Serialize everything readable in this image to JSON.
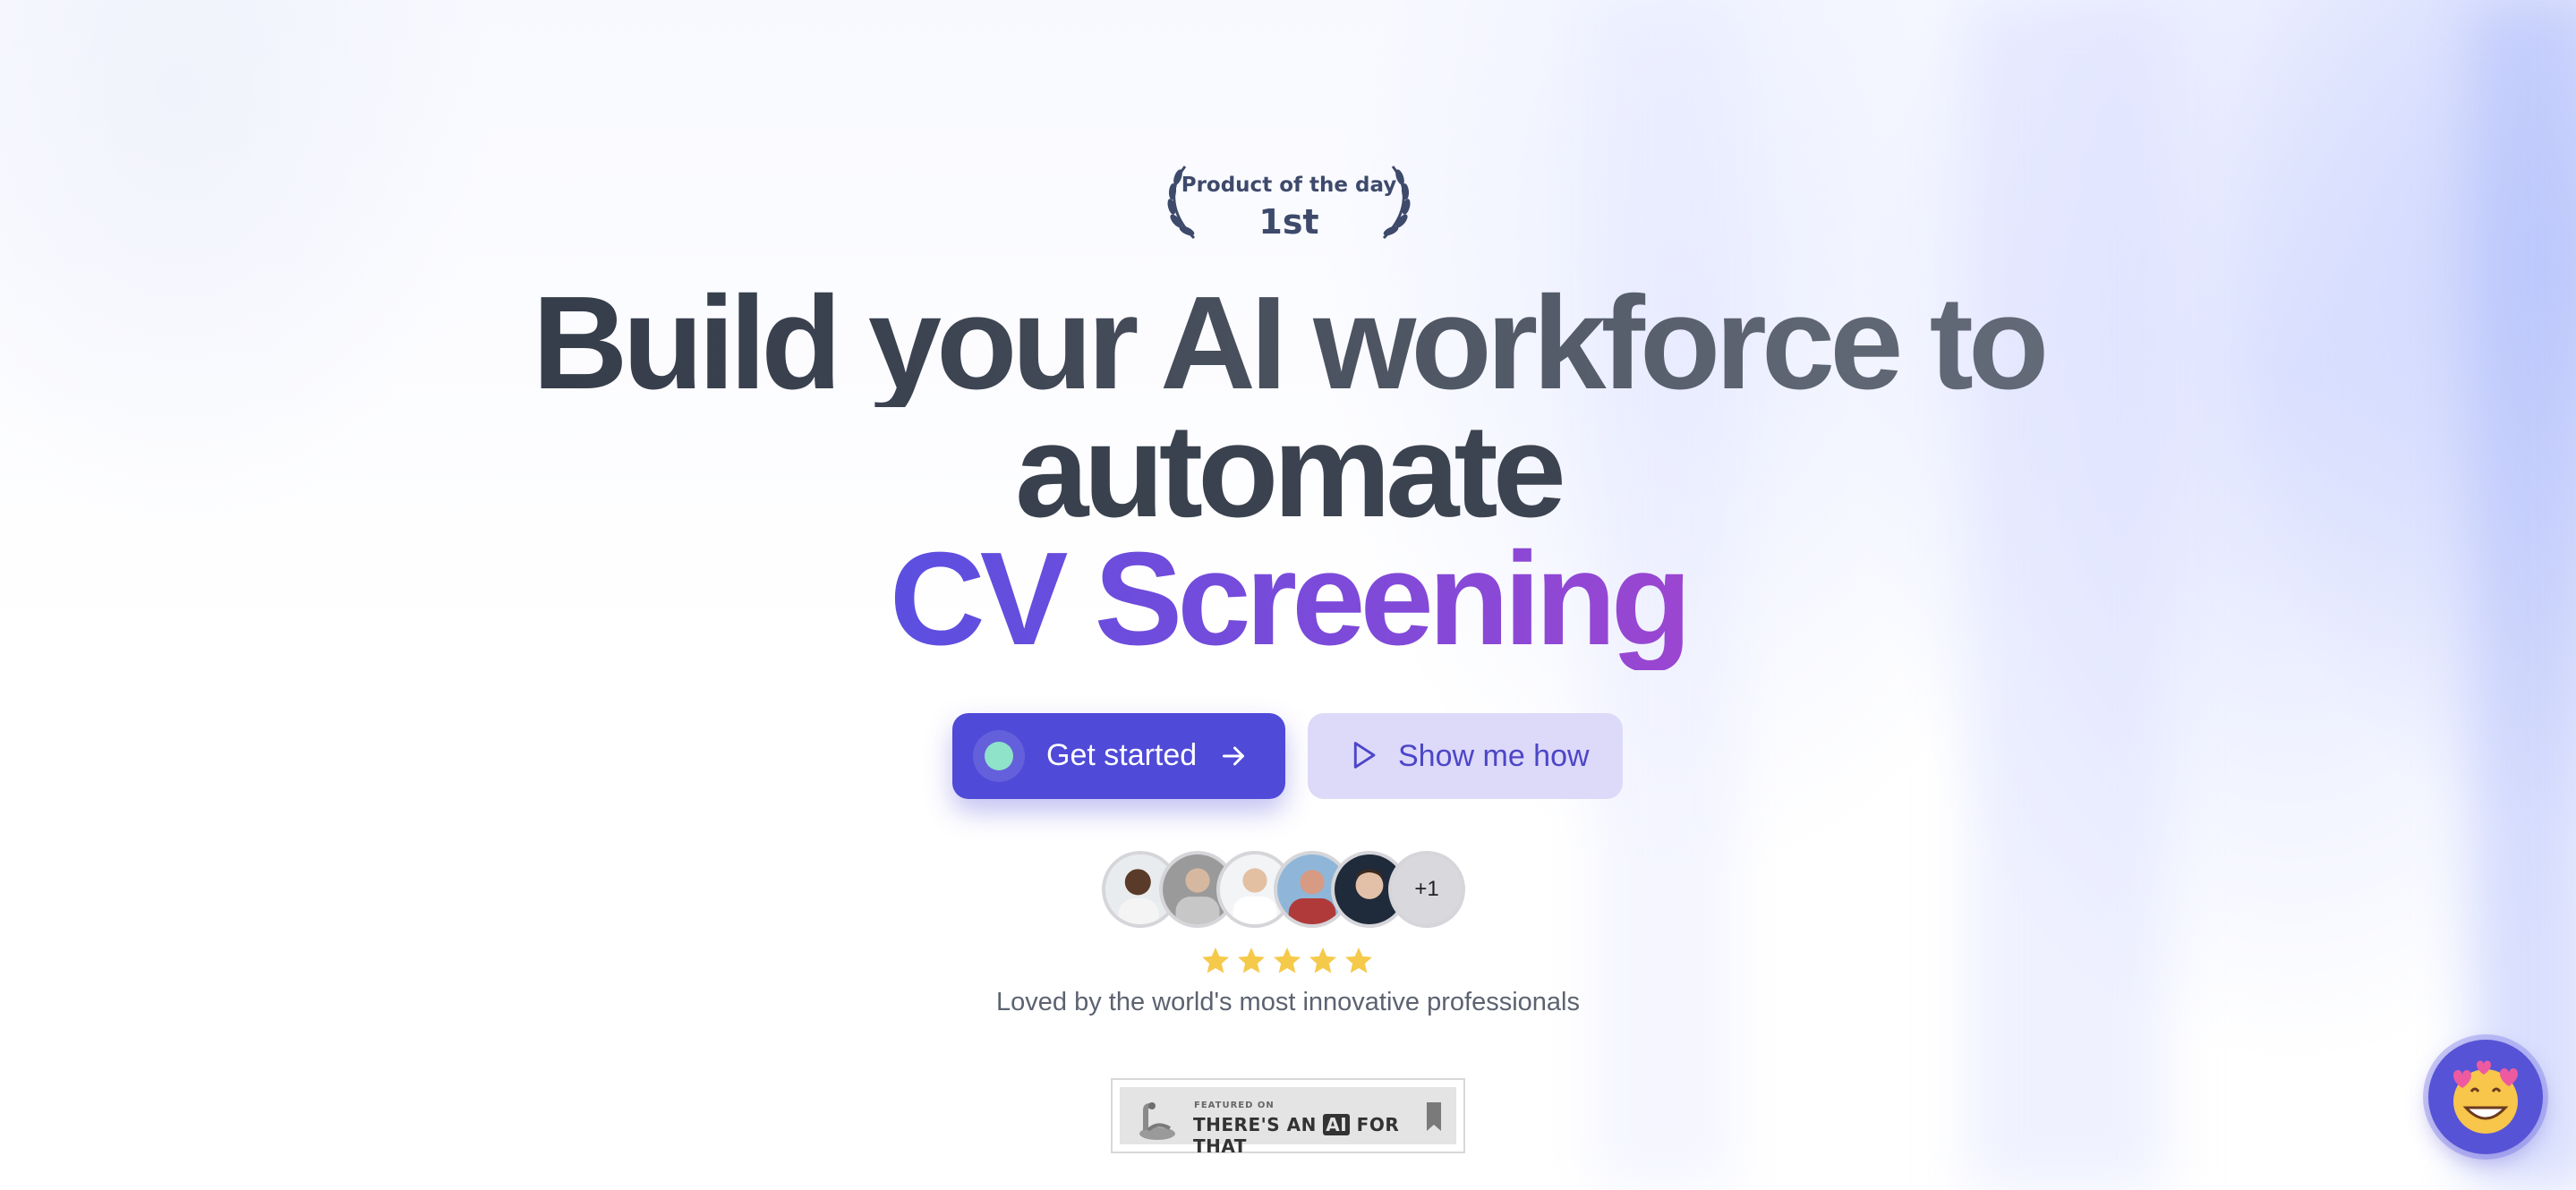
{
  "badge": {
    "label": "Product of the day",
    "rank": "1st"
  },
  "hero": {
    "line1": "Build your AI workforce to",
    "line2": "automate",
    "accent": "CV Screening"
  },
  "cta": {
    "primary_label": "Get started",
    "secondary_label": "Show me how"
  },
  "social_proof": {
    "more_count": "+1",
    "rating_stars": 5,
    "tagline": "Loved by the world's most innovative professionals"
  },
  "featured": {
    "small_text": "FEATURED ON",
    "prefix": "THERE'S AN",
    "ai": "AI",
    "suffix": "FOR THAT"
  },
  "colors": {
    "primary": "#4f4ad8",
    "secondary_bg": "#ddd9f8",
    "accent_gradient_start": "#5b4fe0",
    "accent_gradient_end": "#9b46d1",
    "star": "#f5c94a"
  },
  "icons": {
    "primary_dot": "status-dot-icon",
    "primary_arrow": "arrow-right-icon",
    "secondary_play": "play-icon",
    "chat": "smiling-face-with-hearts-icon"
  }
}
